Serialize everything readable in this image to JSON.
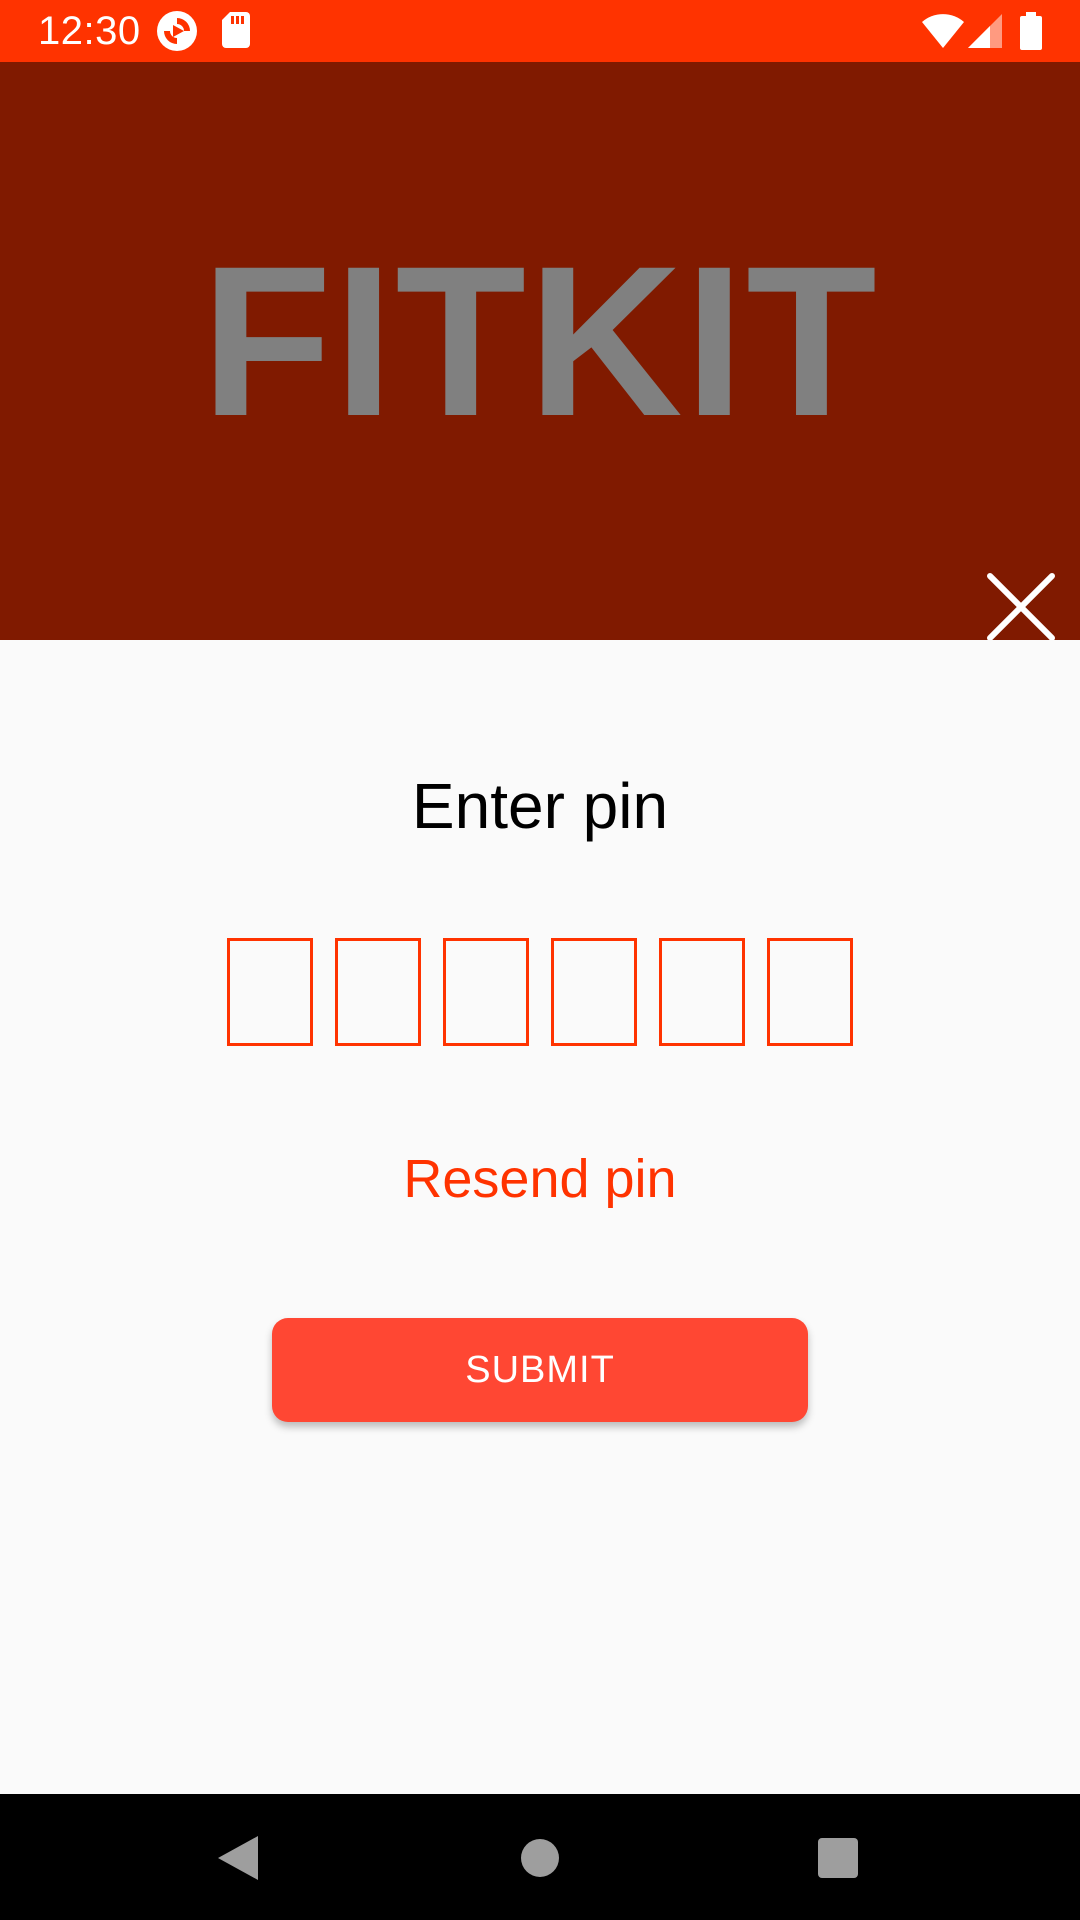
{
  "status_bar": {
    "time": "12:30",
    "icons": [
      "sync-icon",
      "sd-card-icon",
      "wifi-icon",
      "signal-icon",
      "battery-icon"
    ],
    "background_color": "#ff3300"
  },
  "header": {
    "brand": "FITKIT",
    "background_color": "#801a00",
    "brand_color": "#808080",
    "close_icon": "close-icon"
  },
  "main": {
    "title": "Enter pin",
    "pin_digits": 6,
    "pin_values": [
      "",
      "",
      "",
      "",
      "",
      ""
    ],
    "resend_label": "Resend pin",
    "submit_label": "SUBMIT",
    "accent_color": "#ff3300",
    "button_color": "#ff4733"
  },
  "nav_bar": {
    "icons": [
      "back-icon",
      "home-icon",
      "recents-icon"
    ]
  }
}
